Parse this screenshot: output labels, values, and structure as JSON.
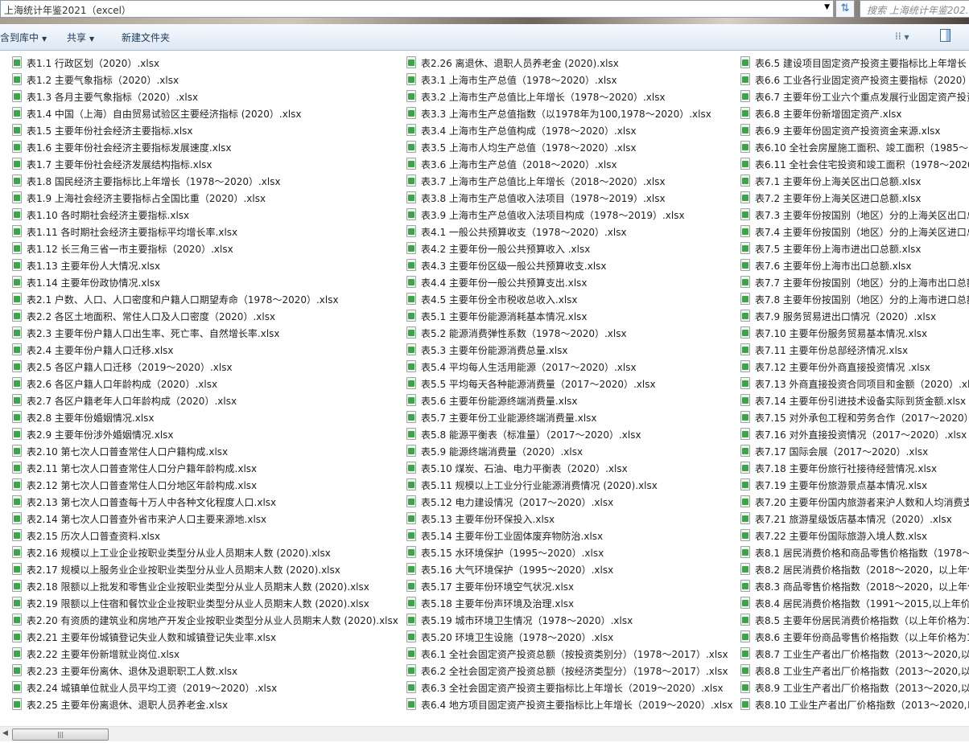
{
  "address_bar": {
    "path": "上海统计年鉴2021（excel）"
  },
  "search": {
    "placeholder": "搜索 上海统计年鉴202..."
  },
  "toolbar": {
    "include_in_library": "包含到库中",
    "share": "共享",
    "new_folder": "新建文件夹"
  },
  "files": {
    "col1": [
      "表1.1 行政区划（2020）.xlsx",
      "表1.2 主要气象指标（2020）.xlsx",
      "表1.3 各月主要气象指标（2020）.xlsx",
      "表1.4 中国（上海）自由贸易试验区主要经济指标 (2020）.xlsx",
      "表1.5 主要年份社会经济主要指标.xlsx",
      "表1.6 主要年份社会经济主要指标发展速度.xlsx",
      "表1.7 主要年份社会经济发展结构指标.xlsx",
      "表1.8 国民经济主要指标比上年增长（1978～2020）.xlsx",
      "表1.9 上海社会经济主要指标占全国比重（2020）.xlsx",
      "表1.10 各时期社会经济主要指标.xlsx",
      "表1.11 各时期社会经济主要指标平均增长率.xlsx",
      "表1.12 长三角三省一市主要指标（2020）.xlsx",
      "表1.13 主要年份人大情况.xlsx",
      "表1.14 主要年份政协情况.xlsx",
      "表2.1 户数、人口、人口密度和户籍人口期望寿命（1978～2020）.xlsx",
      "表2.2 各区土地面积、常住人口及人口密度（2020）.xlsx",
      "表2.3 主要年份户籍人口出生率、死亡率、自然增长率.xlsx",
      "表2.4 主要年份户籍人口迁移.xlsx",
      "表2.5 各区户籍人口迁移（2019～2020）.xlsx",
      "表2.6 各区户籍人口年龄构成（2020）.xlsx",
      "表2.7 各区户籍老年人口年龄构成（2020）.xlsx",
      "表2.8 主要年份婚姻情况.xlsx",
      "表2.9 主要年份涉外婚姻情况.xlsx",
      "表2.10 第七次人口普查常住人口户籍构成.xlsx",
      "表2.11 第七次人口普查常住人口分户籍年龄构成.xlsx",
      "表2.12 第七次人口普查常住人口分地区年龄构成.xlsx",
      "表2.13 第七次人口普查每十万人中各种文化程度人口.xlsx",
      "表2.14 第七次人口普查外省市来沪人口主要来源地.xlsx",
      "表2.15 历次人口普查资料.xlsx",
      "表2.16 规模以上工业企业按职业类型分从业人员期末人数 (2020).xlsx",
      "表2.17 规模以上服务业企业按职业类型分从业人员期末人数 (2020).xlsx",
      "表2.18 限额以上批发和零售业企业按职业类型分从业人员期末人数 (2020).xlsx",
      "表2.19 限额以上住宿和餐饮业企业按职业类型分从业人员期末人数 (2020).xlsx",
      "表2.20 有资质的建筑业和房地产开发企业按职业类型分从业人员期末人数 (2020).xlsx",
      "表2.21 主要年份城镇登记失业人数和城镇登记失业率.xlsx",
      "表2.22 主要年份新增就业岗位.xlsx",
      "表2.23 主要年份离休、退休及退职职工人数.xlsx",
      "表2.24 城镇单位就业人员平均工资（2019～2020）.xlsx",
      "表2.25 主要年份离退休、退职人员养老金.xlsx"
    ],
    "col2": [
      "表2.26 离退休、退职人员养老金 (2020).xlsx",
      "表3.1 上海市生产总值（1978～2020）.xlsx",
      "表3.2 上海市生产总值比上年增长（1978～2020）.xlsx",
      "表3.3 上海市生产总值指数（以1978年为100,1978～2020）.xlsx",
      "表3.4 上海市生产总值构成（1978～2020）.xlsx",
      "表3.5 上海市人均生产总值（1978～2020）.xlsx",
      "表3.6 上海市生产总值（2018～2020）.xlsx",
      "表3.7 上海市生产总值比上年增长（2018～2020）.xlsx",
      "表3.8 上海市生产总值收入法项目（1978～2019）.xlsx",
      "表3.9 上海市生产总值收入法项目构成（1978～2019）.xlsx",
      "表4.1 一般公共预算收支（1978～2020）.xlsx",
      "表4.2 主要年份一般公共预算收入 .xlsx",
      "表4.3 主要年份区级一般公共预算收支.xlsx",
      "表4.4 主要年份一般公共预算支出.xlsx",
      "表4.5 主要年份全市税收总收入.xlsx",
      "表5.1 主要年份能源消耗基本情况.xlsx",
      "表5.2 能源消费弹性系数（1978～2020）.xlsx",
      "表5.3 主要年份能源消费总量.xlsx",
      "表5.4 平均每人生活用能源（2017～2020）.xlsx",
      "表5.5 平均每天各种能源消费量（2017～2020）.xlsx",
      "表5.6 主要年份能源终端消费量.xlsx",
      "表5.7 主要年份工业能源终端消费量.xlsx",
      "表5.8 能源平衡表（标准量）（2017～2020）.xlsx",
      "表5.9 能源终端消费量（2020）.xlsx",
      "表5.10 煤炭、石油、电力平衡表（2020）.xlsx",
      "表5.11 规模以上工业分行业能源消费情况 (2020).xlsx",
      "表5.12 电力建设情况（2017～2020）.xlsx",
      "表5.13 主要年份环保投入.xlsx",
      "表5.14 主要年份工业固体废弃物防治.xlsx",
      "表5.15 水环境保护（1995～2020）.xlsx",
      "表5.16 大气环境保护（1995～2020）.xlsx",
      "表5.17 主要年份环境空气状况.xlsx",
      "表5.18 主要年份声环境及治理.xlsx",
      "表5.19 城市环境卫生情况（1978～2020）.xlsx",
      "表5.20 环境卫生设施（1978～2020）.xlsx",
      "表6.1 全社会固定资产投资总额（按投资类别分）（1978～2017）.xlsx",
      "表6.2 全社会固定资产投资总额（按经济类型分）（1978～2017）.xlsx",
      "表6.3 全社会固定资产投资主要指标比上年增长（2019～2020）.xlsx",
      "表6.4 地方项目固定资产投资主要指标比上年增长（2019～2020）.xlsx"
    ],
    "col3": [
      "表6.5 建设项目固定资产投资主要指标比上年增长",
      "表6.6 工业各行业固定资产投资主要指标（2020）",
      "表6.7 主要年份工业六个重点发展行业固定资产投资",
      "表6.8 主要年份新增固定资产.xlsx",
      "表6.9 主要年份固定资产投资资金来源.xlsx",
      "表6.10 全社会房屋施工面积、竣工面积（1985～2",
      "表6.11 全社会住宅投资和竣工面积（1978～2020",
      "表7.1 主要年份上海关区出口总额.xlsx",
      "表7.2 主要年份上海关区进口总额.xlsx",
      "表7.3 主要年份按国别（地区）分的上海关区出口总",
      "表7.4 主要年份按国别（地区）分的上海关区进口总",
      "表7.5 主要年份上海市进出口总额.xlsx",
      "表7.6 主要年份上海市出口总额.xlsx",
      "表7.7 主要年份按国别（地区）分的上海市出口总额",
      "表7.8 主要年份按国别（地区）分的上海市进口总额",
      "表7.9 服务贸易进出口情况（2020）.xlsx",
      "表7.10 主要年份服务贸易基本情况.xlsx",
      "表7.11 主要年份总部经济情况.xlsx",
      "表7.12 主要年份外商直接投资情况 .xlsx",
      "表7.13 外商直接投资合同项目和金额（2020）.xls",
      "表7.14 主要年份引进技术设备实际到货金额.xlsx",
      "表7.15 对外承包工程和劳务合作（2017～2020）.",
      "表7.16 对外直接投资情况（2017～2020）.xlsx",
      "表7.17 国际会展（2017～2020）.xlsx",
      "表7.18 主要年份旅行社接待经营情况.xlsx",
      "表7.19 主要年份旅游景点基本情况.xlsx",
      "表7.20 主要年份国内旅游者来沪人数和人均消费支",
      "表7.21 旅游星级饭店基本情况（2020）.xlsx",
      "表7.22 主要年份国际旅游入境人数.xlsx",
      "表8.1 居民消费价格和商品零售价格指数（1978～",
      "表8.2 居民消费价格指数（2018～2020，以上年价",
      "表8.3 商品零售价格指数（2018～2020，以上年价",
      "表8.4 居民消费价格指数（1991～2015,以上年价格",
      "表8.5 主要年份居民消费价格指数（以上年价格为1",
      "表8.6 主要年份商品零售价格指数（以上年价格为1",
      "表8.7 工业生产者出厂价格指数（2013～2020,以2",
      "表8.8 工业生产者出厂价格指数（2013～2020,以2",
      "表8.9 工业生产者出厂价格指数（2013～2020,以上",
      "表8.10 工业生产者出厂价格指数（2013～2020,以"
    ]
  },
  "icons": {
    "file": "excel-file-icon"
  },
  "colors": {
    "accent": "#3aa648",
    "toolbar": "#dde8f4"
  }
}
